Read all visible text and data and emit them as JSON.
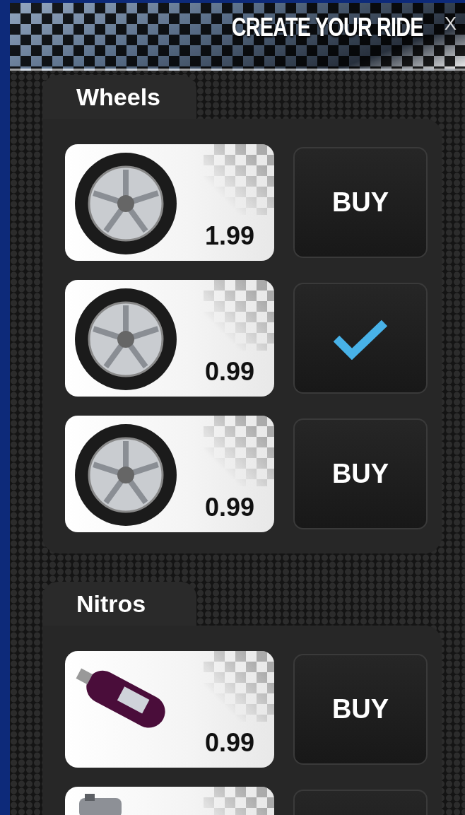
{
  "header": {
    "title": "CREATE YOUR RIDE",
    "close": "X"
  },
  "sections": [
    {
      "title": "Wheels",
      "items": [
        {
          "kind": "wheel",
          "price": "1.99",
          "owned": false,
          "label": "BUY"
        },
        {
          "kind": "wheel",
          "price": "0.99",
          "owned": true
        },
        {
          "kind": "wheel",
          "price": "0.99",
          "owned": false,
          "label": "BUY"
        }
      ]
    },
    {
      "title": "Nitros",
      "items": [
        {
          "kind": "nitro",
          "price": "0.99",
          "owned": false,
          "label": "BUY"
        },
        {
          "kind": "canister"
        }
      ]
    }
  ]
}
